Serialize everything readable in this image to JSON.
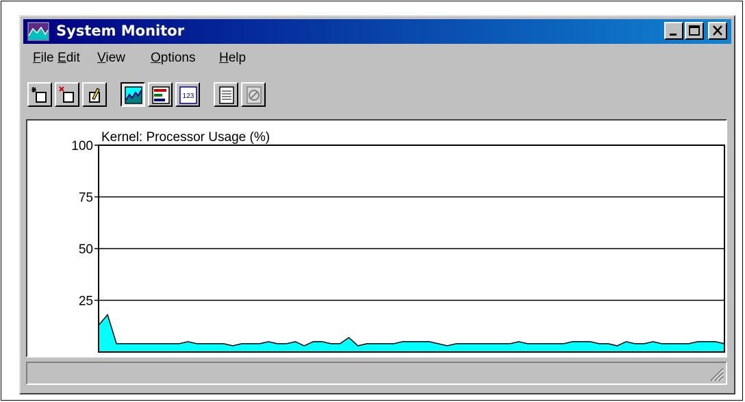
{
  "window": {
    "title": "System Monitor"
  },
  "menu": {
    "items": [
      {
        "label": "File",
        "u": "F",
        "rest": "ile"
      },
      {
        "label": "Edit",
        "u": "E",
        "rest": "dit"
      },
      {
        "label": "View",
        "u": "V",
        "rest": "iew"
      },
      {
        "label": "Options",
        "u": "O",
        "rest": "ptions"
      },
      {
        "label": "Help",
        "u": "H",
        "rest": "elp"
      }
    ]
  },
  "toolbar": {
    "buttons": [
      {
        "name": "add-item-icon"
      },
      {
        "name": "remove-item-icon"
      },
      {
        "name": "edit-item-icon"
      },
      {
        "name": "line-chart-view-icon",
        "pressed": true
      },
      {
        "name": "bar-chart-view-icon"
      },
      {
        "name": "numeric-view-icon"
      },
      {
        "name": "properties-icon"
      },
      {
        "name": "clear-disabled-icon",
        "disabled": true
      }
    ]
  },
  "colors": {
    "fill": "#00ffff",
    "line": "#000000",
    "titlebar_start": "#000080",
    "titlebar_end": "#1084d0"
  },
  "chart_data": {
    "type": "area",
    "title": "Kernel: Processor Usage (%)",
    "ylim": [
      0,
      100
    ],
    "yticks": [
      "100",
      "75",
      "50",
      "25"
    ],
    "grid": true,
    "values": [
      13,
      18,
      4,
      4,
      4,
      4,
      4,
      4,
      4,
      4,
      5,
      4,
      4,
      4,
      4,
      3,
      4,
      4,
      4,
      5,
      4,
      4,
      5,
      3,
      5,
      5,
      4,
      4,
      7,
      3,
      4,
      4,
      4,
      4,
      5,
      5,
      5,
      5,
      4,
      3,
      4,
      4,
      4,
      4,
      4,
      4,
      4,
      5,
      4,
      4,
      4,
      4,
      4,
      5,
      5,
      5,
      4,
      4,
      3,
      5,
      4,
      4,
      5,
      4,
      4,
      4,
      4,
      5,
      5,
      5,
      4
    ]
  }
}
